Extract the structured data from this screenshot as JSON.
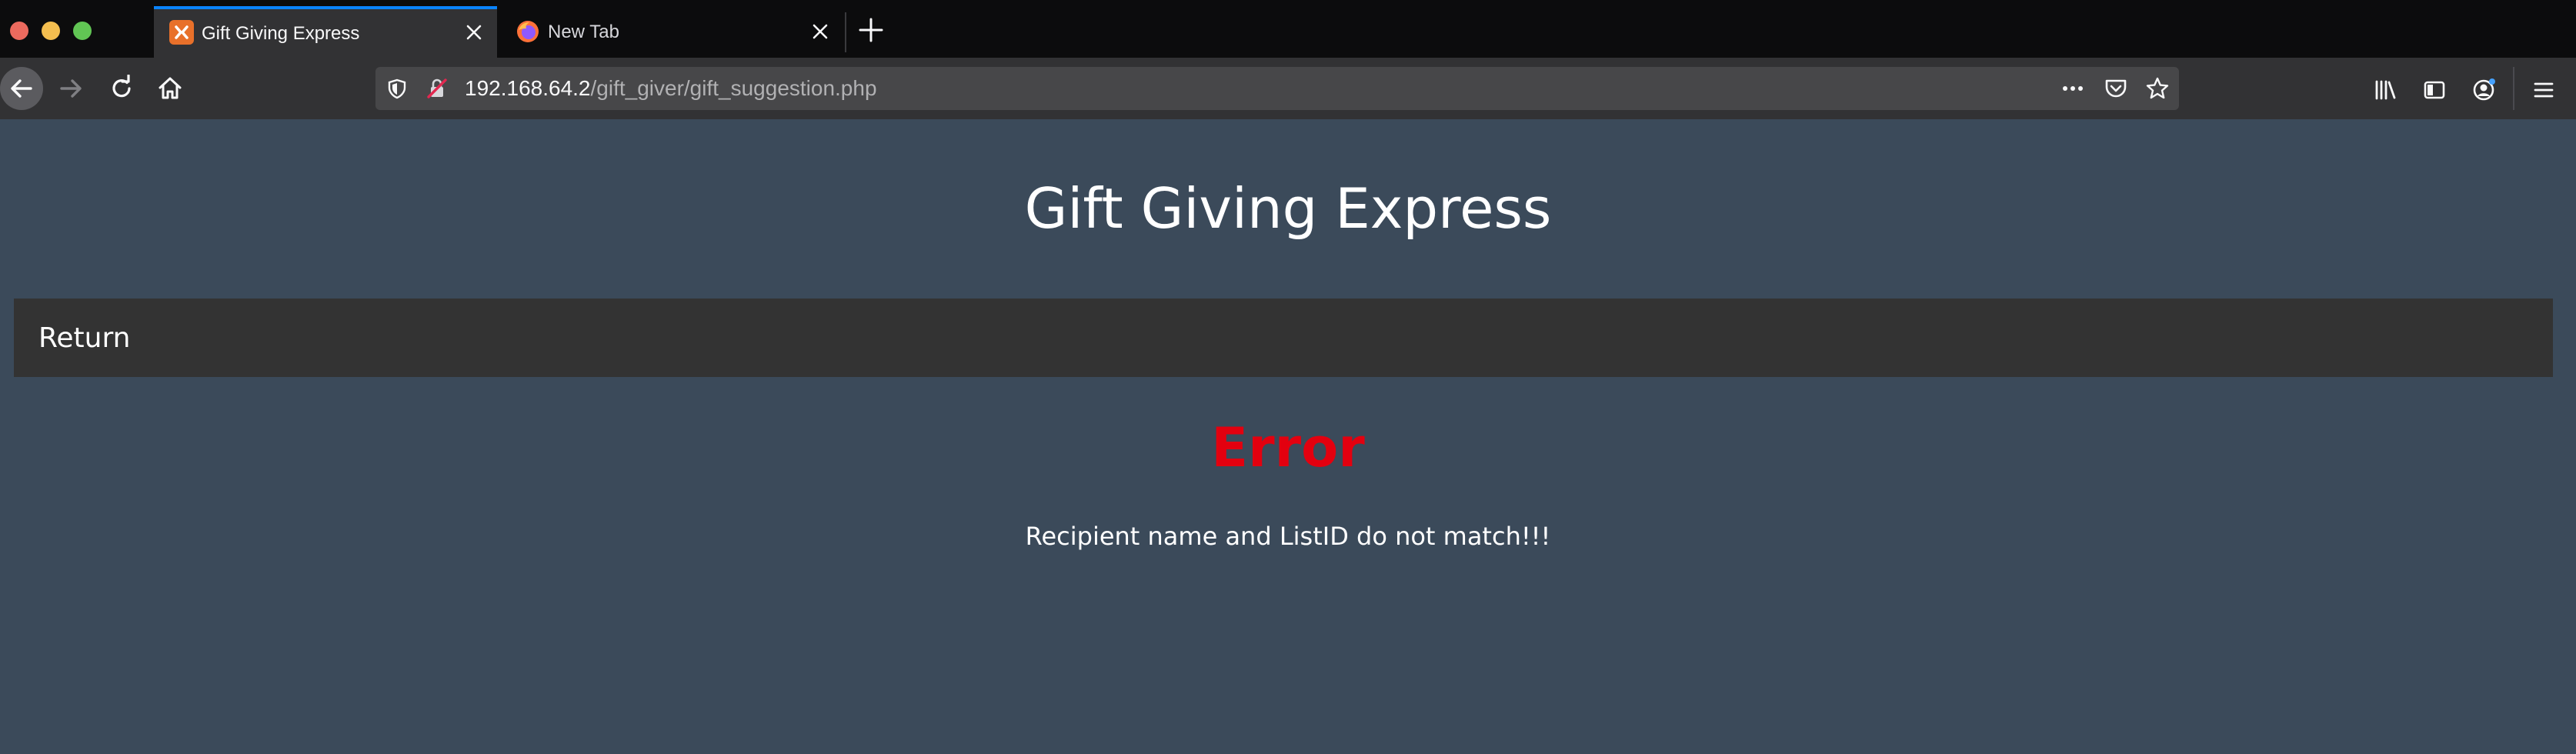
{
  "browser": {
    "tabs": [
      {
        "title": "Gift Giving Express",
        "active": true,
        "favicon": "xampp-icon"
      },
      {
        "title": "New Tab",
        "active": false,
        "favicon": "firefox-icon"
      }
    ],
    "url": {
      "host": "192.168.64.2",
      "path": "/gift_giver/gift_suggestion.php"
    },
    "accent_color": "#0a84ff"
  },
  "page": {
    "site_title": "Gift Giving Express",
    "nav": {
      "return_label": "Return"
    },
    "error": {
      "heading": "Error",
      "message": "Recipient name and ListID do not match!!!",
      "color": "#e3000f"
    },
    "background_color": "#3b4a5a"
  }
}
